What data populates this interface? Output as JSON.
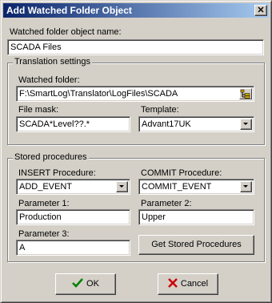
{
  "window": {
    "title": "Add Watched Folder Object",
    "close": "✕"
  },
  "name_label": "Watched folder object name:",
  "name_value": "SCADA Files",
  "translation": {
    "group_title": "Translation settings",
    "folder_label": "Watched folder:",
    "folder_value": "F:\\SmartLog\\Translator\\LogFiles\\SCADA",
    "filemask_label": "File mask:",
    "filemask_value": "SCADA*Level??.*",
    "template_label": "Template:",
    "template_value": "Advant17UK"
  },
  "stored": {
    "group_title": "Stored procedures",
    "insert_label": "INSERT Procedure:",
    "insert_value": "ADD_EVENT",
    "commit_label": "COMMIT Procedure:",
    "commit_value": "COMMIT_EVENT",
    "p1_label": "Parameter 1:",
    "p1_value": "Production",
    "p2_label": "Parameter 2:",
    "p2_value": "Upper",
    "p3_label": "Parameter 3:",
    "p3_value": "A",
    "get_button": "Get Stored Procedures"
  },
  "buttons": {
    "ok": "OK",
    "cancel": "Cancel"
  },
  "colors": {
    "check": "#008000",
    "cross": "#cc0000",
    "title_start": "#0a246a"
  }
}
